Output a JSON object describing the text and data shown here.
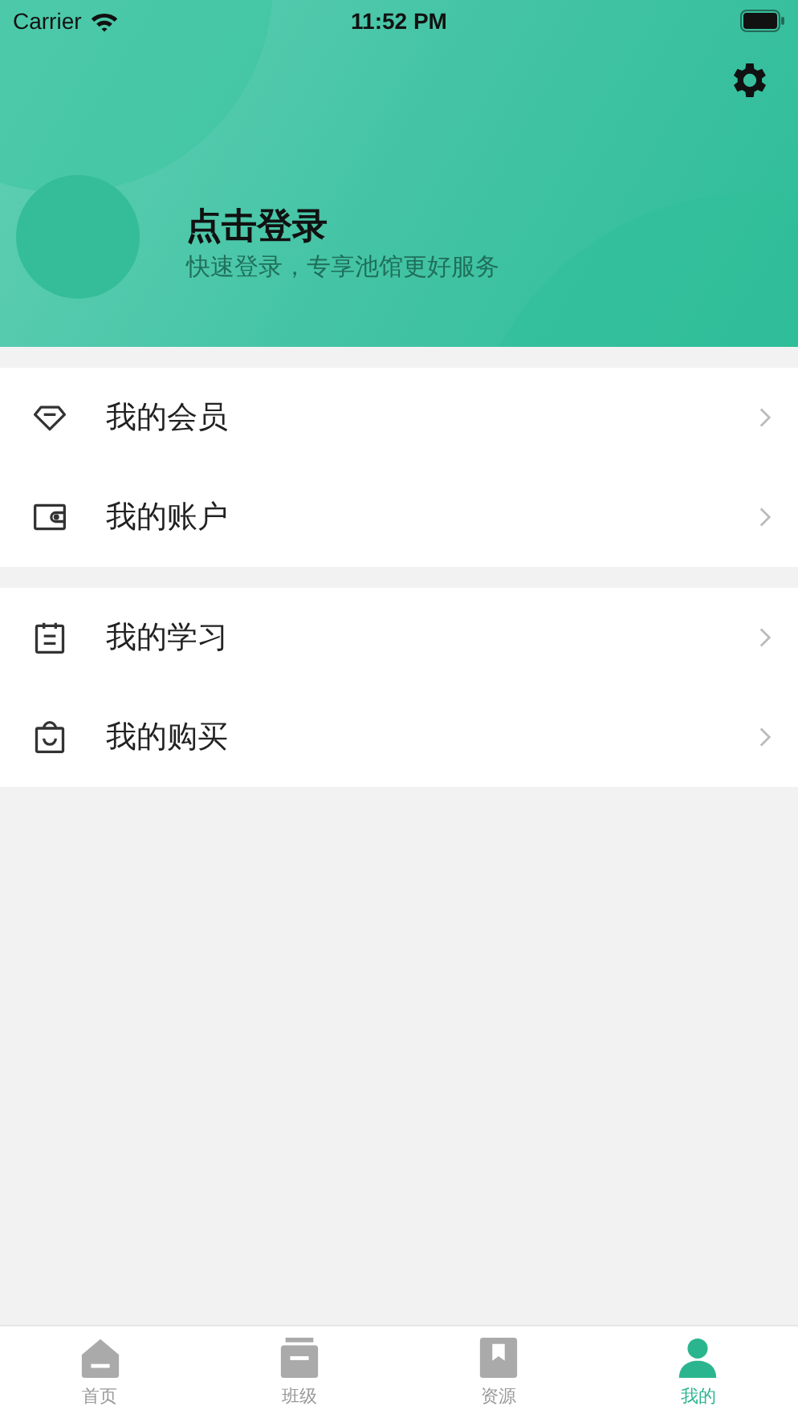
{
  "status_bar": {
    "carrier": "Carrier",
    "time": "11:52 PM"
  },
  "profile": {
    "title": "点击登录",
    "subtitle": "快速登录，专享池馆更好服务"
  },
  "menu_groups": [
    {
      "items": [
        {
          "kind": "diamond",
          "label": "我的会员"
        },
        {
          "kind": "wallet",
          "label": "我的账户"
        }
      ]
    },
    {
      "items": [
        {
          "kind": "calendar",
          "label": "我的学习"
        },
        {
          "kind": "bag",
          "label": "我的购买"
        }
      ]
    }
  ],
  "tab_bar": [
    {
      "kind": "home",
      "label": "首页",
      "selected": false
    },
    {
      "kind": "class",
      "label": "班级",
      "selected": false
    },
    {
      "kind": "book",
      "label": "资源",
      "selected": false
    },
    {
      "kind": "person",
      "label": "我的",
      "selected": true
    }
  ]
}
